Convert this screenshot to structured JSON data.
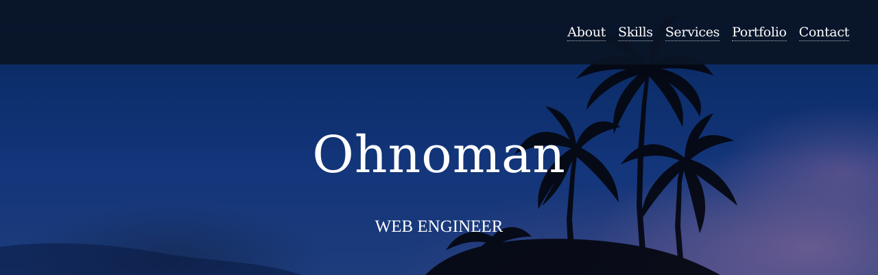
{
  "nav": {
    "items": [
      {
        "label": "About"
      },
      {
        "label": "Skills"
      },
      {
        "label": "Services"
      },
      {
        "label": "Portfolio"
      },
      {
        "label": "Contact"
      }
    ]
  },
  "hero": {
    "title": "Ohnoman",
    "subtitle": "WEB ENGINEER"
  },
  "colors": {
    "navbar_bg": "#0a1426",
    "sky_top": "#0a245a",
    "sky_bottom": "#1d3c7c",
    "dusk_glow": "#7d6496",
    "text": "#ffffff"
  }
}
